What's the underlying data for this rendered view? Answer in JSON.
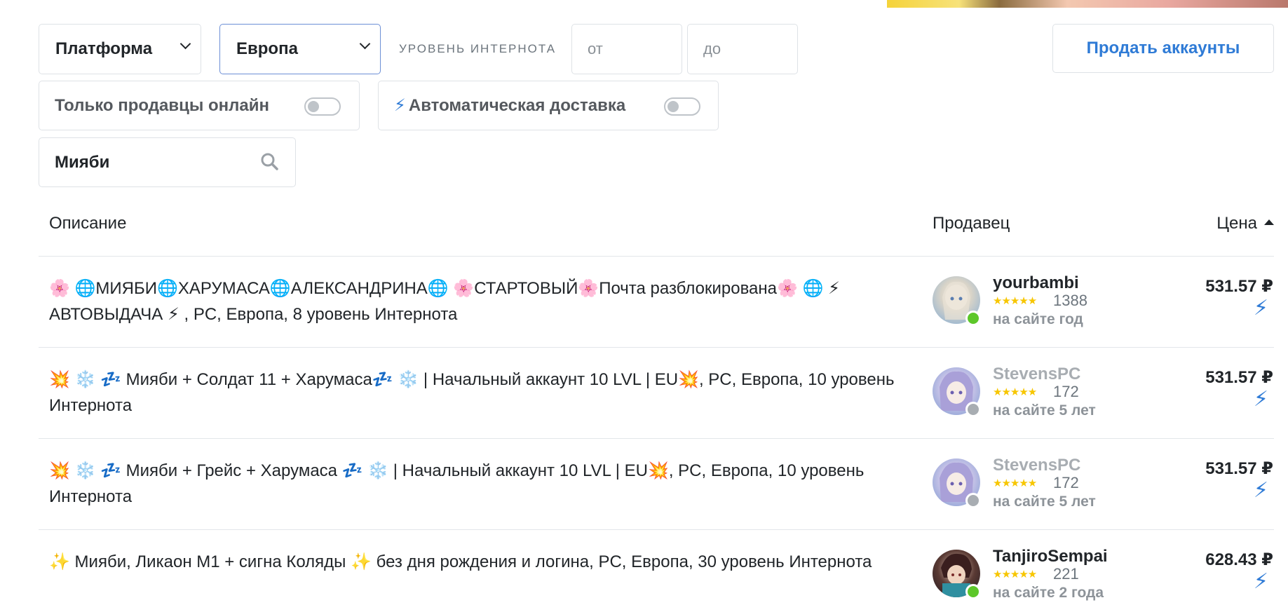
{
  "filters": {
    "platform_select": "Платформа",
    "region_select": "Европа",
    "internet_level_label": "УРОВЕНЬ ИНТЕРНОТА",
    "level_from_placeholder": "от",
    "level_to_placeholder": "до",
    "sell_button": "Продать аккаунты",
    "online_only_label": "Только продавцы онлайн",
    "auto_delivery_label": "Автоматическая доставка",
    "search_value": "Мияби"
  },
  "table": {
    "headers": {
      "description": "Описание",
      "seller": "Продавец",
      "price": "Цена"
    },
    "rows": [
      {
        "description": "🌸 🌐МИЯБИ🌐ХАРУМАСА🌐АЛЕКСАНДРИНА🌐 🌸СТАРТОВЫЙ🌸Почта разблокирована🌸 🌐 ⚡ АВТОВЫДАЧА ⚡ , PC, Европа, 8 уровень Интернота",
        "seller": "yourbambi",
        "stars": "★★★★★",
        "rating": "1388",
        "since": "на сайте год",
        "online": true,
        "price": "531.57 ₽",
        "auto_icon": "lightning-bolt-icon"
      },
      {
        "description": "💥 ❄️ 💤 Мияби + Солдат 11 + Харумаса💤 ❄️ | Начальный аккаунт 10 LVL | EU💥, PC, Европа, 10 уровень Интернота",
        "seller": "StevensPC",
        "stars": "★★★★★",
        "rating": "172",
        "since": "на сайте 5 лет",
        "online": false,
        "price": "531.57 ₽",
        "auto_icon": "lightning-bolt-icon"
      },
      {
        "description": "💥 ❄️ 💤 Мияби + Грейс + Харумаса 💤 ❄️ | Начальный аккаунт 10 LVL | EU💥, PC, Европа, 10 уровень Интернота",
        "seller": "StevensPC",
        "stars": "★★★★★",
        "rating": "172",
        "since": "на сайте 5 лет",
        "online": false,
        "price": "531.57 ₽",
        "auto_icon": "lightning-bolt-icon"
      },
      {
        "description": "✨ Мияби, Ликаон М1 + сигна Коляды ✨ без дня рождения и логина, PC, Европа, 30 уровень Интернота",
        "seller": "TanjiroSempai",
        "stars": "★★★★★",
        "rating": "221",
        "since": "на сайте 2 года",
        "online": true,
        "price": "628.43 ₽",
        "auto_icon": "lightning-bolt-icon"
      }
    ]
  },
  "colors": {
    "accent": "#2f7bd6",
    "online": "#5dc72a",
    "offline": "#a8adb2",
    "star": "#f7c600"
  }
}
